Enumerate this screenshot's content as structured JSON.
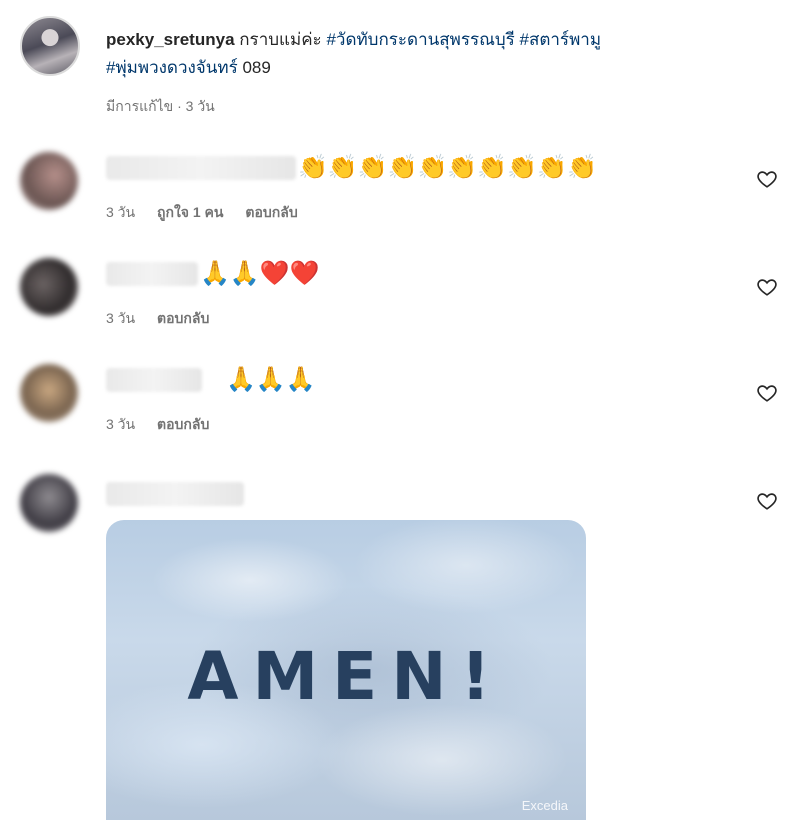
{
  "post": {
    "username": "pexky_sretunya",
    "text": "กราบแม่ค่ะ",
    "hashtags": [
      "#วัดทับกระดานสุพรรณบุรี",
      "#สตาร์พามู",
      "#พุ่มพวงดวงจันทร์"
    ],
    "suffix": "089",
    "meta": "มีการแก้ไข · 3 วัน"
  },
  "comments": [
    {
      "text": "👏👏👏👏👏👏👏👏👏👏",
      "time": "3 วัน",
      "likes": "ถูกใจ 1 คน",
      "reply": "ตอบกลับ"
    },
    {
      "text": "🙏🙏❤️❤️",
      "time": "3 วัน",
      "likes": "",
      "reply": "ตอบกลับ"
    },
    {
      "text": "🙏🙏🙏",
      "time": "3 วัน",
      "likes": "",
      "reply": "ตอบกลับ"
    },
    {
      "text": "",
      "time": "",
      "likes": "",
      "reply": ""
    }
  ],
  "gif": {
    "text": "AMEN!",
    "watermark": "Excedia"
  },
  "colors": {
    "hashtag": "#00376b",
    "meta": "#737373",
    "text": "#262626"
  }
}
